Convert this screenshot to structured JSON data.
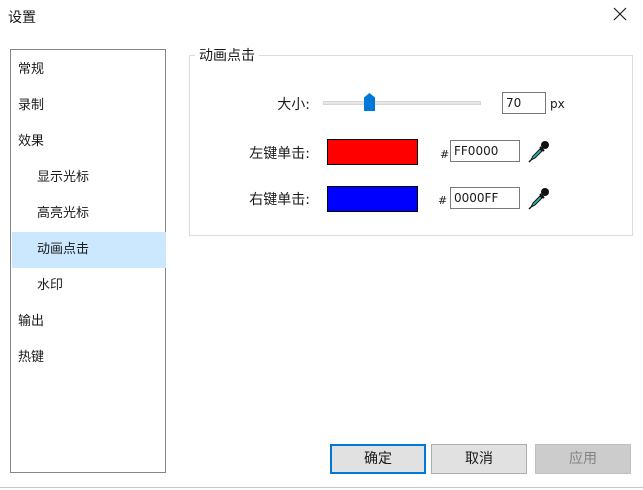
{
  "window": {
    "title": "设置"
  },
  "nav": {
    "items": [
      {
        "label": "常规"
      },
      {
        "label": "录制"
      },
      {
        "label": "效果"
      },
      {
        "label": "显示光标"
      },
      {
        "label": "高亮光标"
      },
      {
        "label": "动画点击"
      },
      {
        "label": "水印"
      },
      {
        "label": "输出"
      },
      {
        "label": "热键"
      }
    ],
    "selected": "动画点击"
  },
  "group": {
    "title": "动画点击",
    "size": {
      "label": "大小:",
      "value": "70",
      "unit": "px",
      "slider_fraction": 0.28
    },
    "left_click": {
      "label": "左键单击:",
      "color": "#FF0000",
      "hash": "#",
      "hex": "FF0000"
    },
    "right_click": {
      "label": "右键单击:",
      "color": "#0000FF",
      "hash": "#",
      "hex": "0000FF"
    }
  },
  "buttons": {
    "ok": "确定",
    "cancel": "取消",
    "apply": "应用"
  },
  "icons": {
    "close": "close-icon",
    "picker": "eyedropper-icon"
  }
}
